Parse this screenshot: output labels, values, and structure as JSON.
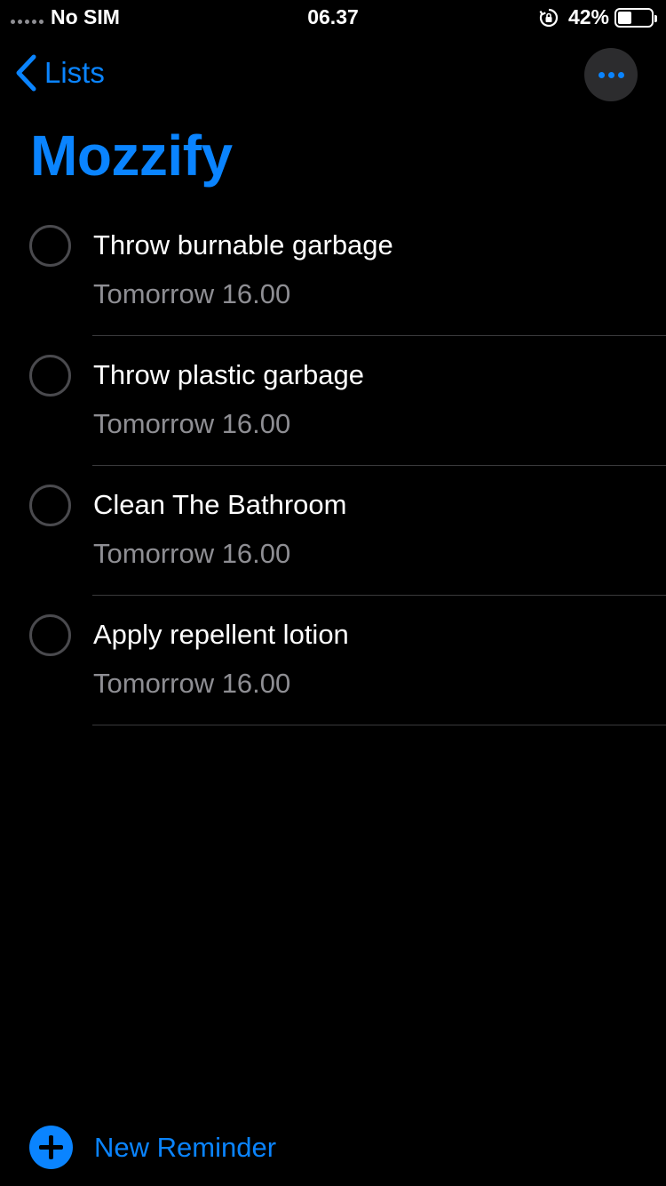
{
  "status_bar": {
    "carrier": "No SIM",
    "time": "06.37",
    "battery_percent": "42%",
    "battery_level": 0.42,
    "icons": [
      "signal-dots-icon",
      "rotation-lock-icon",
      "battery-icon"
    ]
  },
  "nav": {
    "back_label": "Lists",
    "back_icon": "chevron-left-icon",
    "more_icon": "ellipsis-icon"
  },
  "list": {
    "title": "Mozzify",
    "accent_color": "#0a84ff"
  },
  "reminders": [
    {
      "title": "Throw burnable garbage",
      "due": "Tomorrow 16.00"
    },
    {
      "title": "Throw plastic garbage",
      "due": "Tomorrow 16.00"
    },
    {
      "title": "Clean The Bathroom",
      "due": "Tomorrow 16.00"
    },
    {
      "title": "Apply repellent lotion",
      "due": "Tomorrow 16.00"
    }
  ],
  "footer": {
    "new_reminder_label": "New Reminder",
    "new_reminder_icon": "plus-circle-icon"
  }
}
